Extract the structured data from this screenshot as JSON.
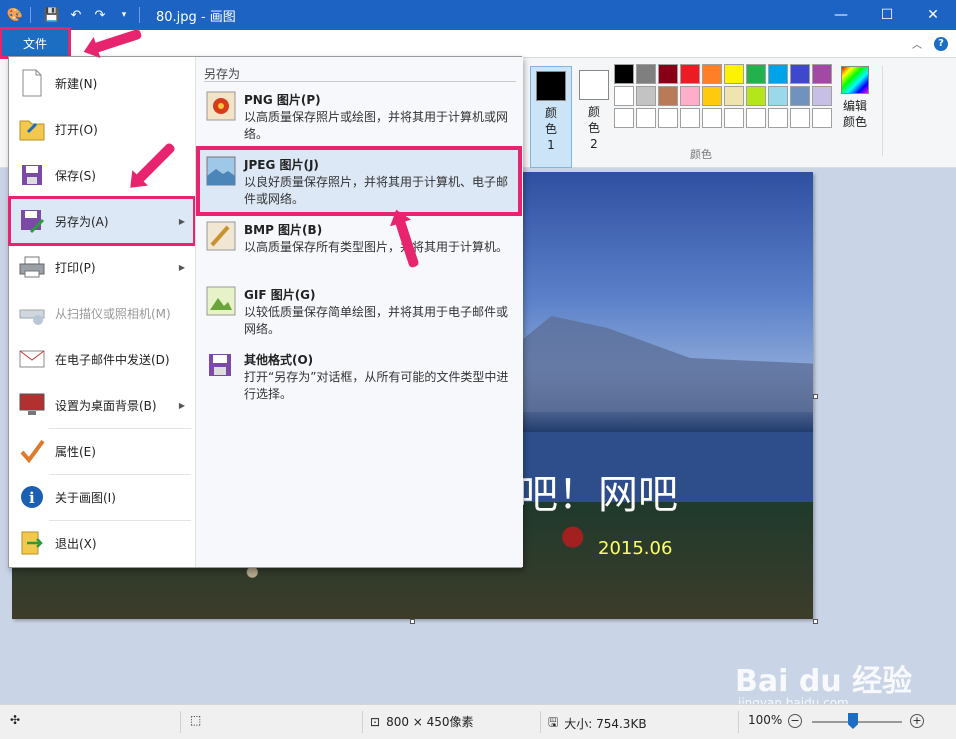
{
  "window": {
    "title": "80.jpg - 画图",
    "controls": {
      "minimize": "—",
      "maximize": "☐",
      "close": "✕"
    }
  },
  "file_tab": {
    "label": "文件"
  },
  "ribbon": {
    "color1_label": "颜色 1",
    "color2_label": "颜色 2",
    "edit_colors_label": "编辑颜色",
    "group_label": "颜色",
    "color1_value": "#000000",
    "color2_value": "#ffffff",
    "palette": [
      "#000000",
      "#7f7f7f",
      "#880015",
      "#ed1c24",
      "#ff7f27",
      "#fff200",
      "#22b14c",
      "#00a2e8",
      "#3f48cc",
      "#a349a4",
      "#ffffff",
      "#c3c3c3",
      "#b97a57",
      "#ffaec9",
      "#ffc90e",
      "#efe4b0",
      "#b5e61d",
      "#99d9ea",
      "#7092be",
      "#c8bfe7",
      "#ffffff",
      "#ffffff",
      "#ffffff",
      "#ffffff",
      "#ffffff",
      "#ffffff",
      "#ffffff",
      "#ffffff",
      "#ffffff",
      "#ffffff"
    ]
  },
  "menu": {
    "items": [
      {
        "label": "新建(N)",
        "icon": "new-file-icon",
        "arrow": false
      },
      {
        "label": "打开(O)",
        "icon": "open-folder-icon",
        "arrow": false
      },
      {
        "label": "保存(S)",
        "icon": "save-icon",
        "arrow": false
      },
      {
        "label": "另存为(A)",
        "icon": "save-as-icon",
        "arrow": true
      },
      {
        "label": "打印(P)",
        "icon": "printer-icon",
        "arrow": true
      },
      {
        "label": "从扫描仪或照相机(M)",
        "icon": "scanner-icon",
        "arrow": false,
        "disabled": true
      },
      {
        "label": "在电子邮件中发送(D)",
        "icon": "email-icon",
        "arrow": false
      },
      {
        "label": "设置为桌面背景(B)",
        "icon": "desktop-background-icon",
        "arrow": true
      },
      {
        "label": "属性(E)",
        "icon": "checkmark-icon",
        "arrow": false
      },
      {
        "label": "关于画图(I)",
        "icon": "info-icon",
        "arrow": false
      },
      {
        "label": "退出(X)",
        "icon": "exit-icon",
        "arrow": false
      }
    ],
    "submenu": {
      "heading": "另存为",
      "items": [
        {
          "title": "PNG 图片(P)",
          "desc": "以高质量保存照片或绘图，并将其用于计算机或网络。",
          "icon": "png-image-icon"
        },
        {
          "title": "JPEG 图片(J)",
          "desc": "以良好质量保存照片，并将其用于计算机、电子邮件或网络。",
          "icon": "jpeg-image-icon"
        },
        {
          "title": "BMP 图片(B)",
          "desc": "以高质量保存所有类型图片，并将其用于计算机。",
          "icon": "bmp-image-icon"
        },
        {
          "title": "GIF 图片(G)",
          "desc": "以较低质量保存简单绘图，并将其用于电子邮件或网络。",
          "icon": "gif-image-icon"
        },
        {
          "title": "其他格式(O)",
          "desc": "打开“另存为”对话框，从所有可能的文件类型中进行选择。",
          "icon": "other-format-icon"
        }
      ]
    }
  },
  "image": {
    "text": "吧！网吧",
    "date": "2015.06",
    "watermark": "Bai du 经验",
    "watermark_sub": "jingyan.baidu.com"
  },
  "status": {
    "dimensions": "800 × 450像素",
    "size": "大小: 754.3KB",
    "zoom": "100%"
  }
}
